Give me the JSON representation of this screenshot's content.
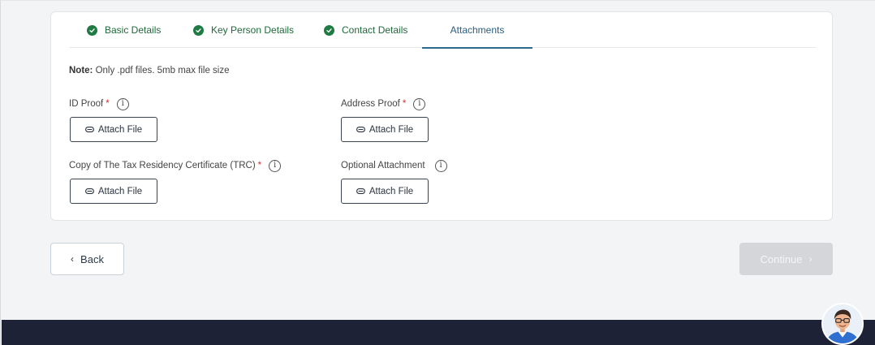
{
  "tabs": [
    {
      "label": "Basic Details",
      "status": "done"
    },
    {
      "label": "Key Person Details",
      "status": "done"
    },
    {
      "label": "Contact Details",
      "status": "done"
    },
    {
      "label": "Attachments",
      "status": "active"
    }
  ],
  "note": {
    "prefix": "Note:",
    "text": "Only .pdf files. 5mb max file size"
  },
  "fields": [
    {
      "label": "ID Proof",
      "required": "*",
      "button": "Attach File"
    },
    {
      "label": "Address Proof",
      "required": "*",
      "button": "Attach File"
    },
    {
      "label": "Copy of The Tax Residency Certificate (TRC)",
      "required": "*",
      "button": "Attach File"
    },
    {
      "label": "Optional Attachment",
      "required": "",
      "button": "Attach File"
    }
  ],
  "info_glyph": "i",
  "nav": {
    "back_label": "Back",
    "back_glyph": "‹",
    "continue_label": "Continue",
    "continue_glyph": "›"
  },
  "colors": {
    "done_tab": "#1e6a3a",
    "active_tab": "#2b5d7f",
    "required": "#d32f2f",
    "continue_disabled": "#d4d6da",
    "footer": "#1d2236"
  },
  "icons": {
    "tab_status": "check-circle-icon",
    "field_info": "info-circle-icon",
    "attach": "paperclip-icon",
    "assistant": "assistant-avatar"
  }
}
